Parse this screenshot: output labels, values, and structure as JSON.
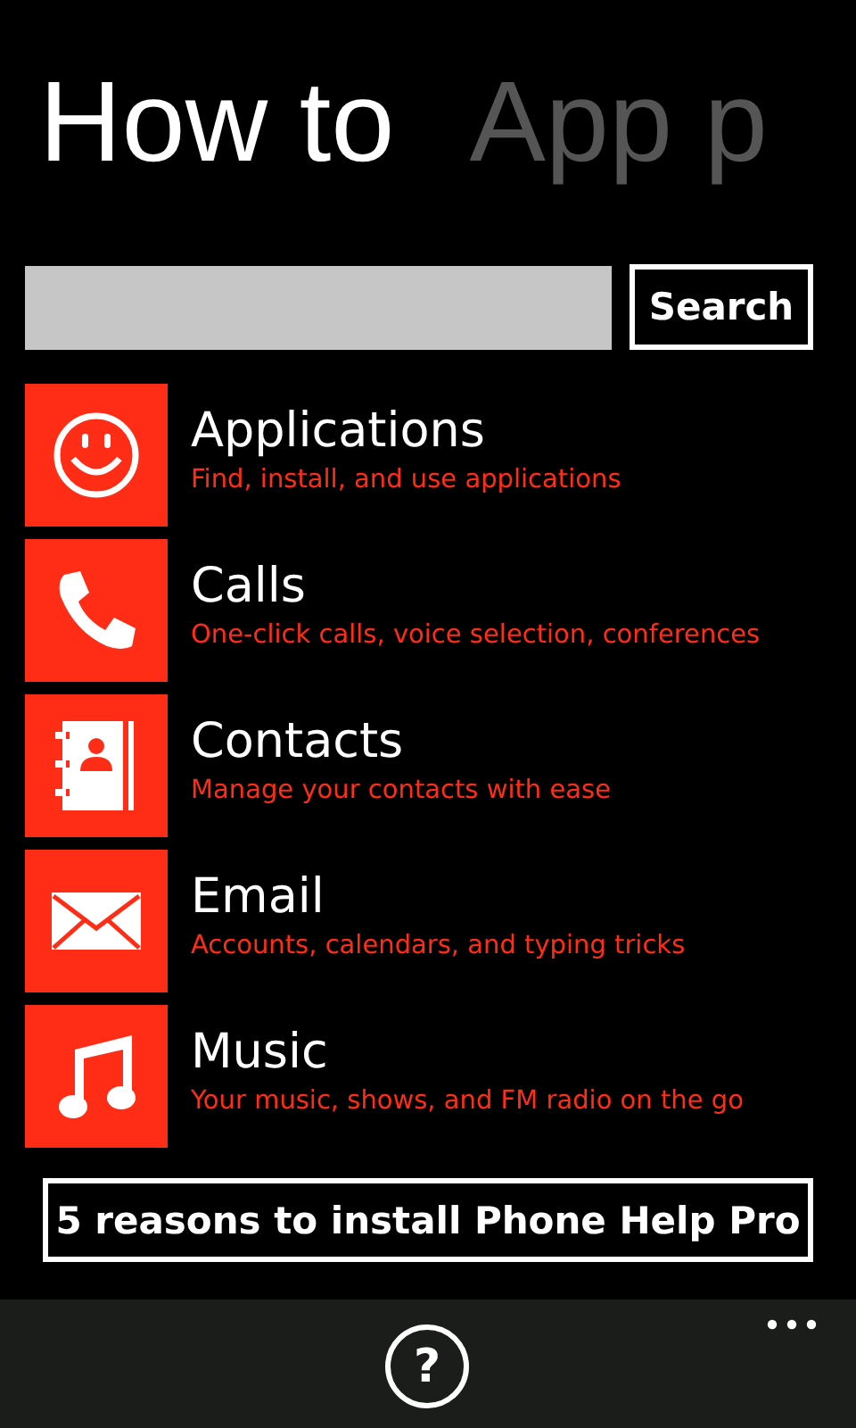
{
  "pivot": {
    "headers": [
      {
        "label": "How to",
        "selected": true
      },
      {
        "label": "App p",
        "selected": false
      }
    ]
  },
  "search": {
    "button": "Search"
  },
  "topics": [
    {
      "kind": "smiley",
      "title": "Applications",
      "subtitle": "Find, install, and use applications"
    },
    {
      "kind": "phone",
      "title": "Calls",
      "subtitle": "One-click calls, voice selection, conferences"
    },
    {
      "kind": "contacts",
      "title": "Contacts",
      "subtitle": "Manage your contacts with ease"
    },
    {
      "kind": "mail",
      "title": "Email",
      "subtitle": "Accounts, calendars, and typing tricks"
    },
    {
      "kind": "music",
      "title": "Music",
      "subtitle": "Your music, shows, and FM radio on the go"
    }
  ],
  "promo_button": "5 reasons to install Phone Help Pro",
  "app_bar": {
    "help_glyph": "?"
  }
}
